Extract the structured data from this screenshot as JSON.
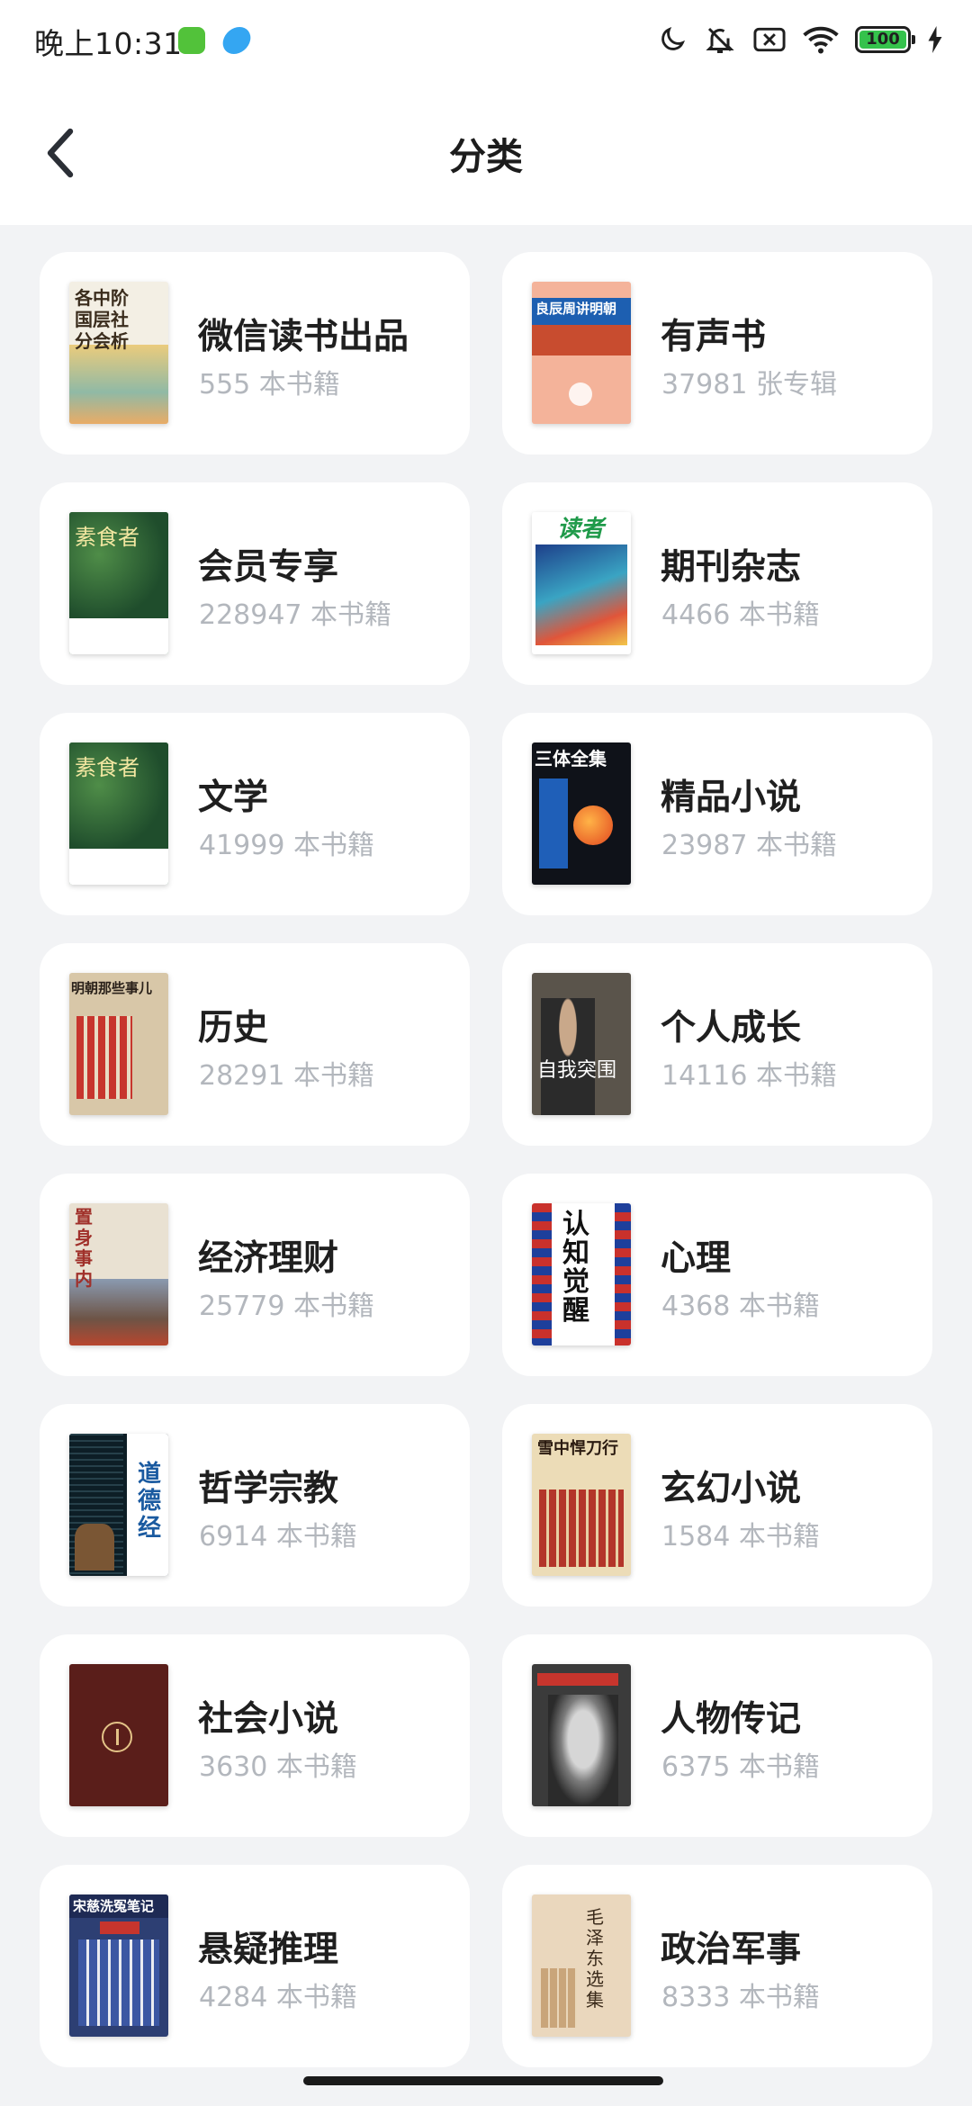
{
  "status_bar": {
    "time": "晚上10:31",
    "battery": "100"
  },
  "header": {
    "title": "分类"
  },
  "categories": [
    {
      "name": "微信读书出品",
      "count": "555 本书籍",
      "cover_icon": "book-cover-social-classes",
      "cover_color": "#f3efe4",
      "cover_label": "各中阶国层社分会析"
    },
    {
      "name": "有声书",
      "count": "37981 张专辑",
      "cover_icon": "audiobook-cover",
      "cover_color": "#f4b39a",
      "cover_label": "良辰周讲明朝"
    },
    {
      "name": "会员专享",
      "count": "228947 本书籍",
      "cover_icon": "book-cover-vegetarian",
      "cover_color": "#2f6a3c",
      "cover_label": "素食者"
    },
    {
      "name": "期刊杂志",
      "count": "4466 本书籍",
      "cover_icon": "magazine-cover-duzhe",
      "cover_color": "#2e6fa8",
      "cover_label": "读者"
    },
    {
      "name": "文学",
      "count": "41999 本书籍",
      "cover_icon": "book-cover-vegetarian",
      "cover_color": "#2f6a3c",
      "cover_label": "素食者"
    },
    {
      "name": "精品小说",
      "count": "23987 本书籍",
      "cover_icon": "book-cover-three-body",
      "cover_color": "#0f1219",
      "cover_label": "三体全集"
    },
    {
      "name": "历史",
      "count": "28291 本书籍",
      "cover_icon": "book-cover-ming-dynasty",
      "cover_color": "#d8c7a8",
      "cover_label": "明朝那些事儿"
    },
    {
      "name": "个人成长",
      "count": "14116 本书籍",
      "cover_icon": "book-cover-self-breakthrough",
      "cover_color": "#5a544b",
      "cover_label": "自我突围"
    },
    {
      "name": "经济理财",
      "count": "25779 本书籍",
      "cover_icon": "book-cover-economics",
      "cover_color": "#e9e1d2",
      "cover_label": "置身事内"
    },
    {
      "name": "心理",
      "count": "4368 本书籍",
      "cover_icon": "book-cover-cognitive-awakening",
      "cover_color": "#ffffff",
      "cover_label": "认知觉醒"
    },
    {
      "name": "哲学宗教",
      "count": "6914 本书籍",
      "cover_icon": "book-cover-tao-te-ching",
      "cover_color": "#0d1e26",
      "cover_label": "道德经"
    },
    {
      "name": "玄幻小说",
      "count": "1584 本书籍",
      "cover_icon": "book-cover-fantasy",
      "cover_color": "#ecdcb7",
      "cover_label": "雪中悍刀行"
    },
    {
      "name": "社会小说",
      "count": "3630 本书籍",
      "cover_icon": "book-cover-social-novel",
      "cover_color": "#5a1e1a",
      "cover_label": ""
    },
    {
      "name": "人物传记",
      "count": "6375 本书籍",
      "cover_icon": "book-cover-biography",
      "cover_color": "#3b3b3b",
      "cover_label": ""
    },
    {
      "name": "悬疑推理",
      "count": "4284 本书籍",
      "cover_icon": "book-cover-mystery",
      "cover_color": "#2d3f73",
      "cover_label": "宋慈洗冤笔记"
    },
    {
      "name": "政治军事",
      "count": "8333 本书籍",
      "cover_icon": "book-cover-politics",
      "cover_color": "#ead7bd",
      "cover_label": "毛泽东选集"
    }
  ]
}
